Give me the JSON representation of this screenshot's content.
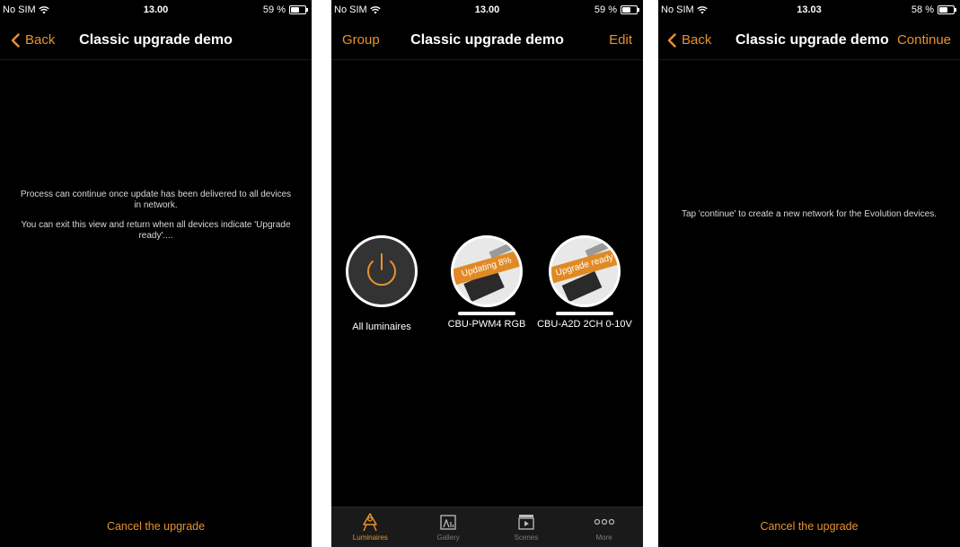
{
  "colors": {
    "accent": "#e8922c",
    "badge": "#e08a25",
    "background": "#000000",
    "tab_inactive": "#7a7a7a"
  },
  "screen1": {
    "status": {
      "carrier": "No SIM",
      "time": "13.00",
      "battery": "59 %",
      "battery_level": 0.59
    },
    "nav": {
      "back_label": "Back",
      "title": "Classic upgrade demo"
    },
    "message": {
      "line1": "Process can continue once update has been delivered to all devices in network.",
      "line2": "You can exit this view and return when all devices indicate 'Upgrade ready'...."
    },
    "cancel_label": "Cancel the upgrade"
  },
  "screen2": {
    "status": {
      "carrier": "No SIM",
      "time": "13.00",
      "battery": "59 %",
      "battery_level": 0.59
    },
    "nav": {
      "left_label": "Group",
      "title": "Classic upgrade demo",
      "right_label": "Edit"
    },
    "luminaires": [
      {
        "label": "All luminaires",
        "icon": "power-icon"
      },
      {
        "label": "CBU-PWM4 RGB",
        "badge": "Updating 8%"
      },
      {
        "label": "CBU-A2D 2CH 0-10V",
        "badge": "Upgrade ready"
      }
    ],
    "tabs": [
      {
        "label": "Luminaires",
        "icon": "lamp-icon",
        "active": true
      },
      {
        "label": "Gallery",
        "icon": "gallery-icon",
        "active": false
      },
      {
        "label": "Scenes",
        "icon": "clapperboard-icon",
        "active": false
      },
      {
        "label": "More",
        "icon": "more-icon",
        "active": false
      }
    ]
  },
  "screen3": {
    "status": {
      "carrier": "No SIM",
      "time": "13.03",
      "battery": "58 %",
      "battery_level": 0.58
    },
    "nav": {
      "back_label": "Back",
      "title": "Classic upgrade demo",
      "right_label": "Continue"
    },
    "message": {
      "line1": "Tap 'continue' to create a new network for the Evolution devices."
    },
    "cancel_label": "Cancel the upgrade"
  }
}
